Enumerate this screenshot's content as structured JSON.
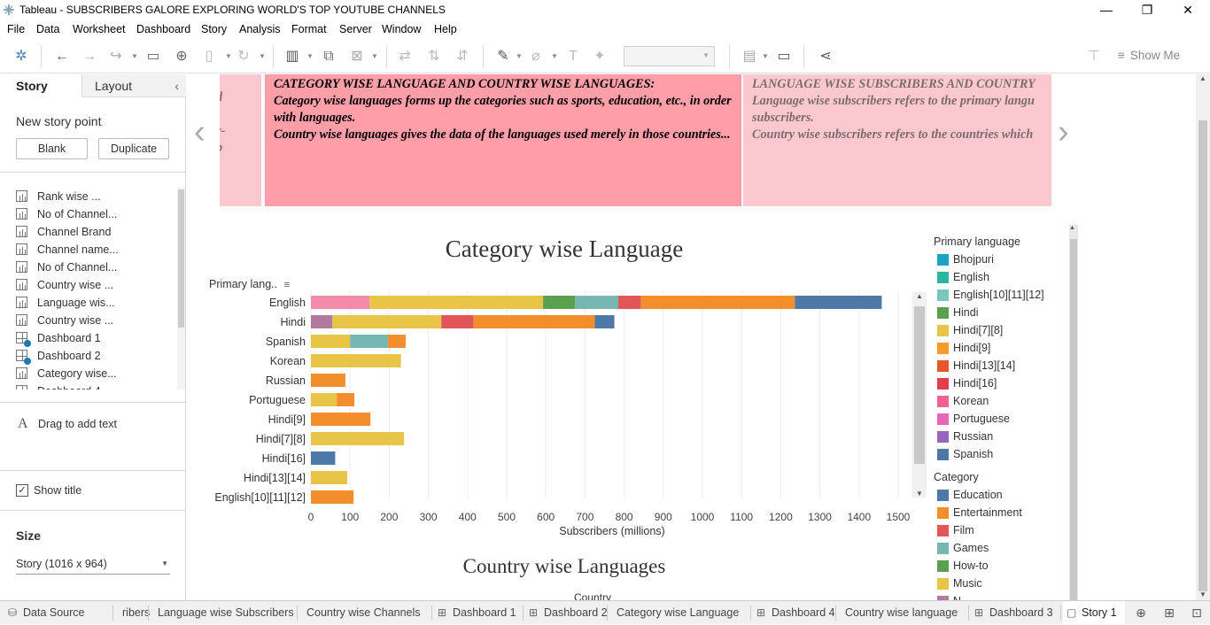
{
  "window": {
    "title": "Tableau - SUBSCRIBERS GALORE EXPLORING WORLD'S TOP YOUTUBE CHANNELS",
    "controls": [
      "—",
      "❐",
      "✕"
    ]
  },
  "menu": [
    "File",
    "Data",
    "Worksheet",
    "Dashboard",
    "Story",
    "Analysis",
    "Format",
    "Server",
    "Window",
    "Help"
  ],
  "toolbar": {
    "show_me": "Show Me"
  },
  "sidebar": {
    "tabs": {
      "story": "Story",
      "layout": "Layout"
    },
    "new_story_point": "New story point",
    "blank": "Blank",
    "duplicate": "Duplicate",
    "sheets": [
      {
        "label": "Rank wise ...",
        "kind": "sheet"
      },
      {
        "label": "No of Channel...",
        "kind": "sheet"
      },
      {
        "label": "Channel Brand",
        "kind": "sheet"
      },
      {
        "label": "Channel name...",
        "kind": "sheet"
      },
      {
        "label": "No of Channel...",
        "kind": "sheet"
      },
      {
        "label": "Country wise ...",
        "kind": "sheet"
      },
      {
        "label": "Language wis...",
        "kind": "sheet"
      },
      {
        "label": "Country wise ...",
        "kind": "sheet"
      },
      {
        "label": "Dashboard 1",
        "kind": "dashboard"
      },
      {
        "label": "Dashboard 2",
        "kind": "dashboard"
      },
      {
        "label": "Category wise...",
        "kind": "sheet"
      },
      {
        "label": "Dashboard 4",
        "kind": "dashboard"
      }
    ],
    "drag_text": "Drag to add text",
    "show_title": "Show title",
    "size_label": "Size",
    "size_value": "Story (1016 x 964)"
  },
  "story": {
    "card_left_fragments": [
      "d",
      "r-",
      "p"
    ],
    "card_active": {
      "title": "CATEGORY  WISE LANGUAGE AND COUNTRY  WISE LANGUAGES:",
      "line1": "Category wise languages forms up the categories such as sports, education, etc., in order with languages.",
      "line2": "Country wise languages gives the data of the languages used merely in those countries..."
    },
    "card_right": {
      "title": "LANGUAGE WISE SUBSCRIBERS AND COUNTRY",
      "line1": "Language wise subscribers refers to the primary langu",
      "line1b": "subscribers.",
      "line2": "Country wise subscribers refers to the countries which"
    },
    "nav_prev": "‹",
    "nav_next": "›"
  },
  "chart_data": {
    "type": "bar",
    "stacked": true,
    "orientation": "horizontal",
    "title": "Category wise Language",
    "row_header": "Primary lang..",
    "xlabel": "Subscribers (millions)",
    "xlim": [
      0,
      1500
    ],
    "xticks": [
      0,
      100,
      200,
      300,
      400,
      500,
      600,
      700,
      800,
      900,
      1000,
      1100,
      1200,
      1300,
      1400,
      1500
    ],
    "grid": true,
    "categories": [
      "English",
      "Hindi",
      "Spanish",
      "Korean",
      "Russian",
      "Portuguese",
      "Hindi[9]",
      "Hindi[7][8]",
      "Hindi[16]",
      "Hindi[13][14]",
      "English[10][11][12]"
    ],
    "rows": [
      {
        "label": "English",
        "segments": [
          {
            "color": "#F28CA8",
            "value": 150
          },
          {
            "color": "#E8C547",
            "value": 443
          },
          {
            "color": "#59A14F",
            "value": 82
          },
          {
            "color": "#76B7B2",
            "value": 110
          },
          {
            "color": "#E15759",
            "value": 58
          },
          {
            "color": "#F28E2B",
            "value": 393
          },
          {
            "color": "#4E79A7",
            "value": 222
          }
        ]
      },
      {
        "label": "Hindi",
        "segments": [
          {
            "color": "#B07AA1",
            "value": 55
          },
          {
            "color": "#E8C547",
            "value": 278
          },
          {
            "color": "#E15759",
            "value": 82
          },
          {
            "color": "#F28E2B",
            "value": 310
          },
          {
            "color": "#4E79A7",
            "value": 50
          }
        ]
      },
      {
        "label": "Spanish",
        "segments": [
          {
            "color": "#E8C547",
            "value": 100
          },
          {
            "color": "#76B7B2",
            "value": 97
          },
          {
            "color": "#F28E2B",
            "value": 45
          }
        ]
      },
      {
        "label": "Korean",
        "segments": [
          {
            "color": "#E8C547",
            "value": 230
          }
        ]
      },
      {
        "label": "Russian",
        "segments": [
          {
            "color": "#F28E2B",
            "value": 88
          }
        ]
      },
      {
        "label": "Portuguese",
        "segments": [
          {
            "color": "#E8C547",
            "value": 66
          },
          {
            "color": "#F28E2B",
            "value": 45
          }
        ]
      },
      {
        "label": "Hindi[9]",
        "segments": [
          {
            "color": "#F28E2B",
            "value": 152
          }
        ]
      },
      {
        "label": "Hindi[7][8]",
        "segments": [
          {
            "color": "#E8C547",
            "value": 238
          }
        ]
      },
      {
        "label": "Hindi[16]",
        "segments": [
          {
            "color": "#4E79A7",
            "value": 62
          }
        ]
      },
      {
        "label": "Hindi[13][14]",
        "segments": [
          {
            "color": "#E8C547",
            "value": 93
          }
        ]
      },
      {
        "label": "English[10][11][12]",
        "segments": [
          {
            "color": "#F28E2B",
            "value": 109
          }
        ]
      }
    ],
    "legend_language_title": "Primary language",
    "legend_language": [
      {
        "name": "Bhojpuri",
        "color": "#1BA3C6"
      },
      {
        "name": "English",
        "color": "#2CB5A0"
      },
      {
        "name": "English[10][11][12]",
        "color": "#7AC8BD"
      },
      {
        "name": "Hindi",
        "color": "#59A14F"
      },
      {
        "name": "Hindi[7][8]",
        "color": "#E8C547"
      },
      {
        "name": "Hindi[9]",
        "color": "#F49B2A"
      },
      {
        "name": "Hindi[13][14]",
        "color": "#E6562C"
      },
      {
        "name": "Hindi[16]",
        "color": "#E03E4E"
      },
      {
        "name": "Korean",
        "color": "#F06292"
      },
      {
        "name": "Portuguese",
        "color": "#E667B6"
      },
      {
        "name": "Russian",
        "color": "#9467BD"
      },
      {
        "name": "Spanish",
        "color": "#4E79A7"
      }
    ],
    "legend_category_title": "Category",
    "legend_category": [
      {
        "name": "Education",
        "color": "#4E79A7"
      },
      {
        "name": "Entertainment",
        "color": "#F28E2B"
      },
      {
        "name": "Film",
        "color": "#E15759"
      },
      {
        "name": "Games",
        "color": "#76B7B2"
      },
      {
        "name": "How-to",
        "color": "#59A14F"
      },
      {
        "name": "Music",
        "color": "#E8C547"
      },
      {
        "name": "N...",
        "color": "#B07AA1"
      }
    ]
  },
  "chart2": {
    "title": "Country wise Languages",
    "header": "Country"
  },
  "tabs": [
    {
      "label": "Data Source",
      "kind": "datasource"
    },
    {
      "label": "ribers",
      "kind": "sheet"
    },
    {
      "label": "Language wise Subscribers",
      "kind": "sheet"
    },
    {
      "label": "Country wise Channels",
      "kind": "sheet"
    },
    {
      "label": "Dashboard 1",
      "kind": "dashboard"
    },
    {
      "label": "Dashboard 2",
      "kind": "dashboard"
    },
    {
      "label": "Category wise Language",
      "kind": "sheet"
    },
    {
      "label": "Dashboard 4",
      "kind": "dashboard"
    },
    {
      "label": "Country wise language",
      "kind": "sheet"
    },
    {
      "label": "Dashboard 3",
      "kind": "dashboard"
    },
    {
      "label": "Story 1",
      "kind": "story",
      "active": true
    }
  ]
}
